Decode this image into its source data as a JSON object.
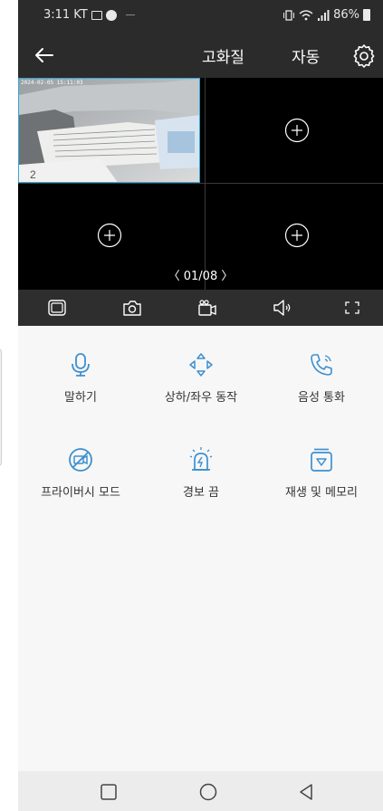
{
  "status_bar": {
    "time": "3:11",
    "carrier": "KT",
    "battery": "86%"
  },
  "app_bar": {
    "quality": "고화질",
    "mode": "자동"
  },
  "video": {
    "overlay_text": "2024-02-05 15:11:03",
    "page_indicator": "〈  01/08  〉"
  },
  "controls": [
    {
      "label": "말하기"
    },
    {
      "label": "상하/좌우 동작"
    },
    {
      "label": "음성 통화"
    },
    {
      "label": "프라이버시 모드"
    },
    {
      "label": "경보 끔"
    },
    {
      "label": "재생 및 메모리"
    }
  ],
  "colors": {
    "accent": "#3d90d0",
    "bar": "#2b2b2b",
    "grid_border": "#34a9d8"
  },
  "icons": [
    "back-arrow-icon",
    "gear-icon",
    "add-icon",
    "multi-view-icon",
    "camera-icon",
    "video-record-icon",
    "speaker-icon",
    "fullscreen-icon",
    "microphone-icon",
    "ptz-icon",
    "phone-call-icon",
    "privacy-icon",
    "alarm-off-icon",
    "playback-icon",
    "square-nav-icon",
    "circle-nav-icon",
    "triangle-nav-icon"
  ]
}
